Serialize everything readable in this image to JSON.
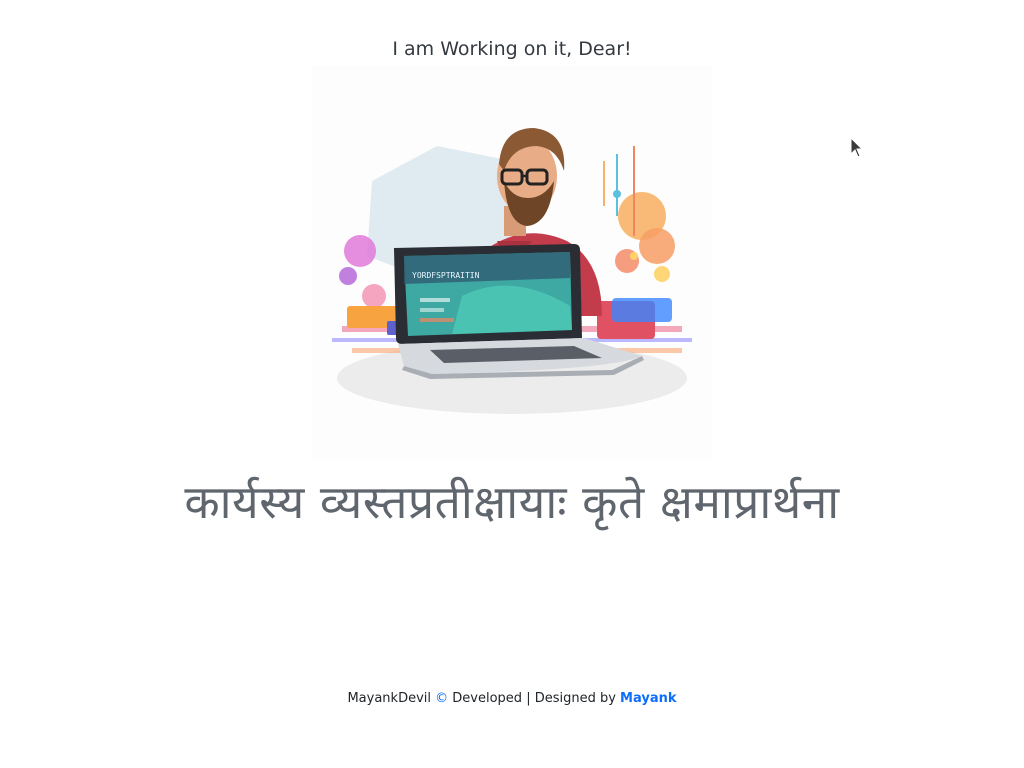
{
  "header": {
    "message": "I am Working on it, Dear!"
  },
  "hero": {
    "laptop_screen_text": "YORDFSPTRAITIN"
  },
  "headline": "कार्यस्य व्यस्तप्रतीक्षायाः कृते क्षमाप्रार्थना",
  "footer": {
    "brand": "MayankDevil",
    "copyright_symbol": "©",
    "middle_text": " Developed | Designed by ",
    "author": "Mayank"
  },
  "colors": {
    "text": "#343a40",
    "headline": "#5f666d",
    "link": "#0d6efd"
  }
}
